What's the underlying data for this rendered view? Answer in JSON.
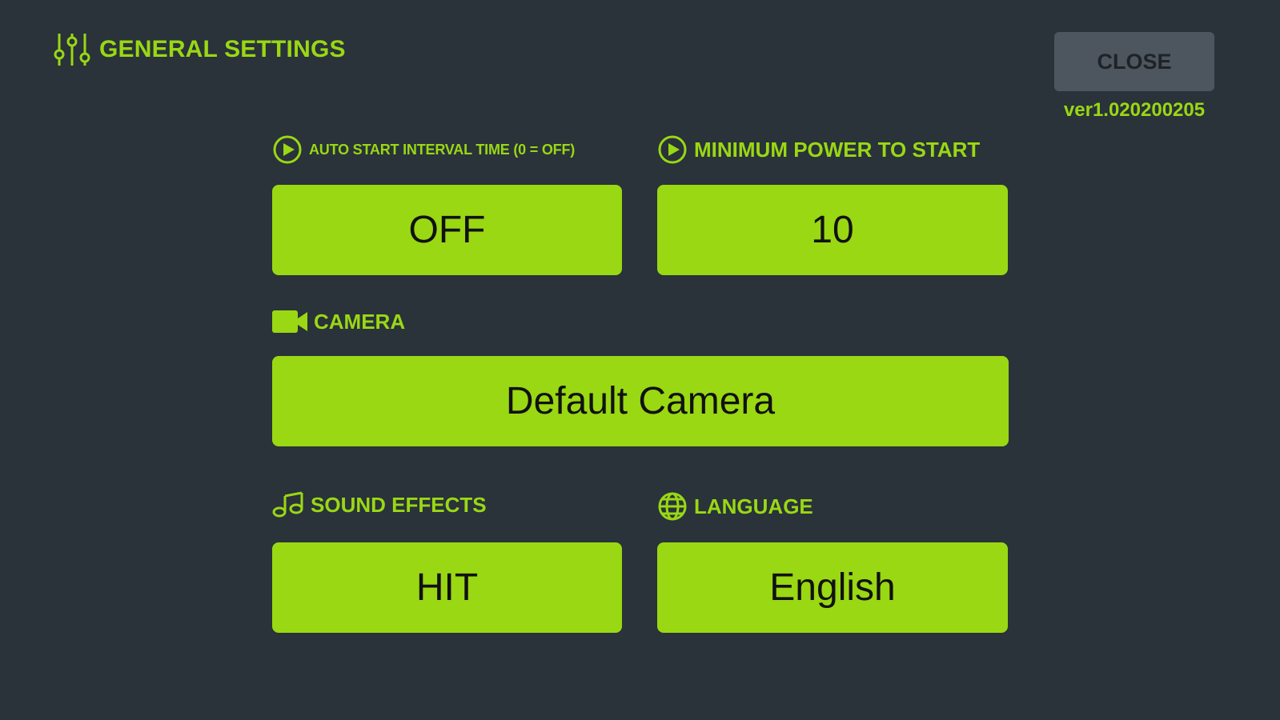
{
  "colors": {
    "background": "#2a323a",
    "accent": "#99d813",
    "close_button_bg": "#4d565e"
  },
  "header": {
    "icon": "sliders-icon",
    "title": "GENERAL SETTINGS"
  },
  "close_button": {
    "label": "CLOSE"
  },
  "version": "ver1.020200205",
  "settings": {
    "auto_start": {
      "icon": "play-circle-icon",
      "label": "AUTO START INTERVAL TIME (0 = OFF)",
      "value": "OFF"
    },
    "minimum_power": {
      "icon": "play-circle-icon",
      "label": "MINIMUM POWER TO START",
      "value": "10"
    },
    "camera": {
      "icon": "video-camera-icon",
      "label": "CAMERA",
      "value": "Default Camera"
    },
    "sound_effects": {
      "icon": "music-note-icon",
      "label": "SOUND EFFECTS",
      "value": "HIT"
    },
    "language": {
      "icon": "globe-icon",
      "label": "LANGUAGE",
      "value": "English"
    }
  }
}
